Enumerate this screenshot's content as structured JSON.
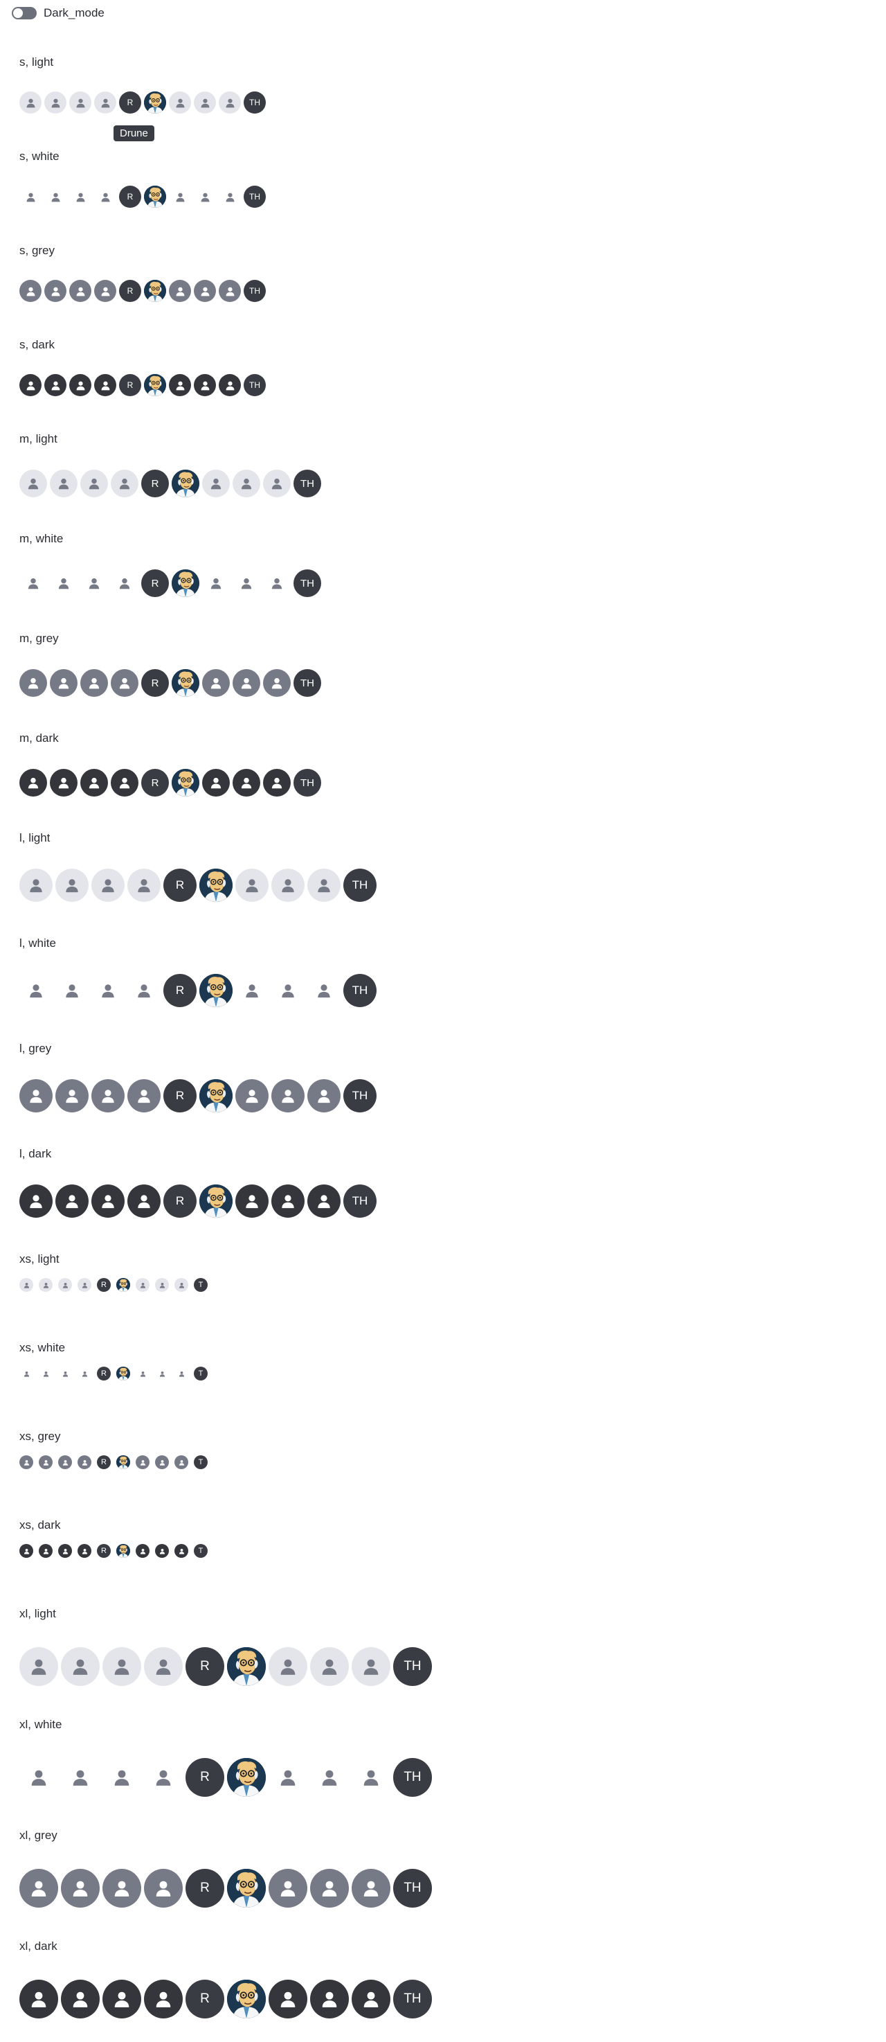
{
  "toggle": {
    "label": "Dark_mode",
    "on": false
  },
  "tooltip": {
    "text": "Drune"
  },
  "avatar_sequence": [
    "person",
    "person",
    "person",
    "person",
    "initial-1",
    "image",
    "person",
    "person",
    "person",
    "initial-2"
  ],
  "sections": [
    {
      "title": "s, light",
      "size": "s",
      "theme": "light",
      "initials": [
        "R",
        "TH"
      ]
    },
    {
      "title": "s, white",
      "size": "s",
      "theme": "white",
      "initials": [
        "R",
        "TH"
      ]
    },
    {
      "title": "s, grey",
      "size": "s",
      "theme": "grey",
      "initials": [
        "R",
        "TH"
      ]
    },
    {
      "title": "s, dark",
      "size": "s",
      "theme": "dark",
      "initials": [
        "R",
        "TH"
      ]
    },
    {
      "title": "m, light",
      "size": "m",
      "theme": "light",
      "initials": [
        "R",
        "TH"
      ]
    },
    {
      "title": "m, white",
      "size": "m",
      "theme": "white",
      "initials": [
        "R",
        "TH"
      ]
    },
    {
      "title": "m, grey",
      "size": "m",
      "theme": "grey",
      "initials": [
        "R",
        "TH"
      ]
    },
    {
      "title": "m, dark",
      "size": "m",
      "theme": "dark",
      "initials": [
        "R",
        "TH"
      ]
    },
    {
      "title": "l, light",
      "size": "l",
      "theme": "light",
      "initials": [
        "R",
        "TH"
      ]
    },
    {
      "title": "l, white",
      "size": "l",
      "theme": "white",
      "initials": [
        "R",
        "TH"
      ]
    },
    {
      "title": "l, grey",
      "size": "l",
      "theme": "grey",
      "initials": [
        "R",
        "TH"
      ]
    },
    {
      "title": "l, dark",
      "size": "l",
      "theme": "dark",
      "initials": [
        "R",
        "TH"
      ]
    },
    {
      "title": "xs, light",
      "size": "xs",
      "theme": "light",
      "initials": [
        "R",
        "T"
      ]
    },
    {
      "title": "xs, white",
      "size": "xs",
      "theme": "white",
      "initials": [
        "R",
        "T"
      ]
    },
    {
      "title": "xs, grey",
      "size": "xs",
      "theme": "grey",
      "initials": [
        "R",
        "T"
      ]
    },
    {
      "title": "xs, dark",
      "size": "xs",
      "theme": "dark",
      "initials": [
        "R",
        "T"
      ]
    },
    {
      "title": "xl, light",
      "size": "xl",
      "theme": "light",
      "initials": [
        "R",
        "TH"
      ]
    },
    {
      "title": "xl, white",
      "size": "xl",
      "theme": "white",
      "initials": [
        "R",
        "TH"
      ]
    },
    {
      "title": "xl, grey",
      "size": "xl",
      "theme": "grey",
      "initials": [
        "R",
        "TH"
      ]
    },
    {
      "title": "xl, dark",
      "size": "xl",
      "theme": "dark",
      "initials": [
        "R",
        "TH"
      ]
    }
  ],
  "colors": {
    "light_bg": "#e4e5ea",
    "light_icon": "#767a86",
    "white_icon": "#767a86",
    "grey_bg": "#767a86",
    "grey_icon": "#ffffff",
    "dark_bg": "#34363c",
    "dark_icon": "#ffffff",
    "initials_bg": "#3a3c43",
    "image_bg": "#1b3850",
    "image_face": "#f0c77e",
    "image_hair": "#e8edf3"
  }
}
